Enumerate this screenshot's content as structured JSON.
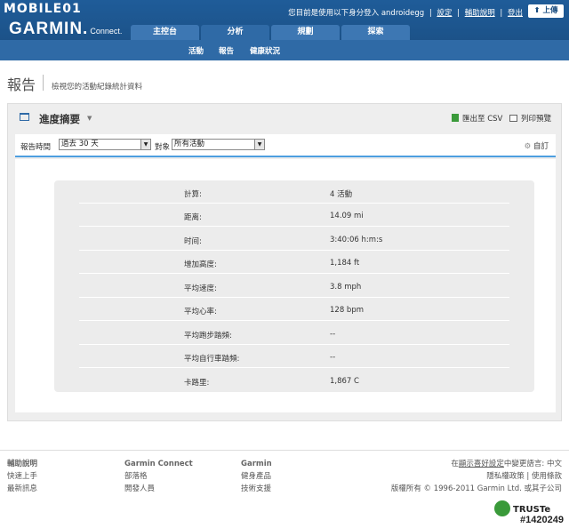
{
  "watermark": {
    "logo": "MOBILE01",
    "id": "#1420249"
  },
  "header": {
    "brand": "GARMIN.",
    "brand_sub": "Connect.",
    "top_links": {
      "signed_in": "您目前是使用以下身分登入 androidegg",
      "settings": "設定",
      "help": "輔助說明",
      "logout": "登出"
    },
    "upload_label": "上傳",
    "tabs": [
      "主控台",
      "分析",
      "規劃",
      "探索"
    ],
    "active_tab": "分析",
    "subnav": [
      "活動",
      "報告",
      "健康狀況"
    ]
  },
  "page": {
    "title": "報告",
    "description": "檢視您的活動紀錄統計資料"
  },
  "report": {
    "title": "進度摘要",
    "export_csv": "匯出至 CSV",
    "print_preview": "列印預覽",
    "filters": {
      "time_label": "報告時間",
      "time_value": "過去 30 天",
      "object_label": "對象",
      "object_value": "所有活動",
      "customize": "自訂"
    },
    "stats": [
      {
        "label": "計算:",
        "value": "4 活動"
      },
      {
        "label": "距离:",
        "value": "14.09 mi"
      },
      {
        "label": "时间:",
        "value": "3:40:06 h:m:s"
      },
      {
        "label": "增加高度:",
        "value": "1,184 ft"
      },
      {
        "label": "平均速度:",
        "value": "3.8 mph"
      },
      {
        "label": "平均心率:",
        "value": "128 bpm"
      },
      {
        "label": "平均跑步踏頻:",
        "value": "--"
      },
      {
        "label": "平均自行車踏頻:",
        "value": "--"
      },
      {
        "label": "卡路里:",
        "value": "1,867 C"
      }
    ]
  },
  "footer": {
    "col1": [
      "輔助說明",
      "快速上手",
      "最新訊息"
    ],
    "col2": [
      "Garmin Connect",
      "部落格",
      "開發人員"
    ],
    "col3": [
      "Garmin",
      "健身產品",
      "技術支援"
    ],
    "lang_line": {
      "pre": "在",
      "link": "顯示喜好設定",
      "post": "中變更語言: 中文"
    },
    "privacy": "隱私權政策",
    "terms": "使用條款",
    "copyright": "版權所有 © 1996-2011 Garmin Ltd. 或其子公司",
    "truste": "TRUSTe"
  }
}
